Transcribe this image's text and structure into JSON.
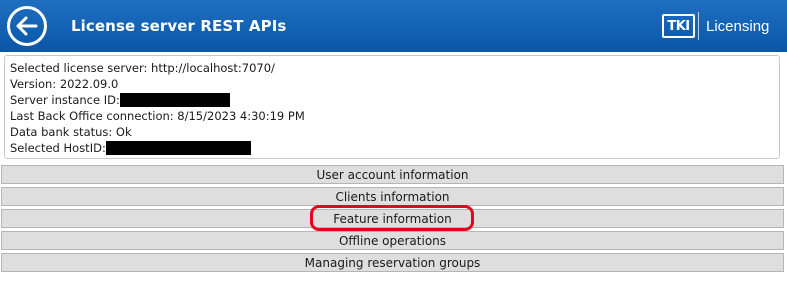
{
  "header": {
    "title": "License server REST APIs",
    "back_icon": "arrow-left-icon",
    "brand_logo": "TKI",
    "brand_text": "Licensing",
    "colors": {
      "bar": "#0a56a8",
      "text": "#ffffff"
    }
  },
  "info": {
    "license_server": "Selected license server: http://localhost:7070/",
    "version": "Version: 2022.09.0",
    "server_instance_label": "Server instance ID:",
    "last_back_office": "Last Back Office connection: 8/15/2023 4:30:19 PM",
    "data_bank_status": "Data bank status: Ok",
    "host_id_label": "Selected HostID:"
  },
  "menu": {
    "items": [
      "User account information",
      "Clients information",
      "Feature information",
      "Offline operations",
      "Managing reservation groups"
    ],
    "highlighted_index": 2,
    "highlight_color": "#e8001c"
  }
}
